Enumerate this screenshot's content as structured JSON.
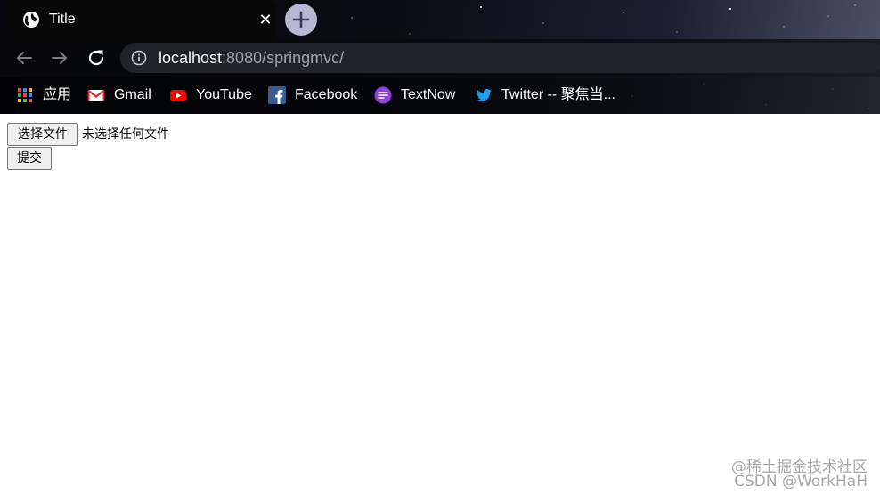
{
  "browser": {
    "tab": {
      "title": "Title",
      "favicon": "globe-icon",
      "close_glyph": "✕"
    },
    "new_tab_icon": "plus-icon",
    "nav": {
      "back_icon": "arrow-left-icon",
      "forward_icon": "arrow-right-icon",
      "reload_icon": "reload-icon",
      "site_info_icon": "info-icon"
    },
    "url": {
      "host": "localhost",
      "rest": ":8080/springmvc/"
    },
    "bookmarks": [
      {
        "label": "应用",
        "icon": "apps-grid-icon"
      },
      {
        "label": "Gmail",
        "icon": "gmail-icon"
      },
      {
        "label": "YouTube",
        "icon": "youtube-icon"
      },
      {
        "label": "Facebook",
        "icon": "facebook-icon"
      },
      {
        "label": "TextNow",
        "icon": "textnow-icon"
      },
      {
        "label": "Twitter -- 聚焦当...",
        "icon": "twitter-icon"
      }
    ]
  },
  "page": {
    "file_input": {
      "button_label": "选择文件",
      "status_text": "未选择任何文件"
    },
    "submit_label": "提交"
  },
  "watermark": {
    "line1": "@稀土掘金技术社区",
    "line2": "CSDN @WorkHaH"
  },
  "colors": {
    "tab_bg": "#080808",
    "new_tab_bg": "#b7b9d4",
    "omnibox_bg": "#202329",
    "url_host": "#f4f4f4",
    "url_rest": "#9ea3ad",
    "page_bg": "#ffffff",
    "button_bg": "#efefef",
    "button_border": "#767676"
  }
}
